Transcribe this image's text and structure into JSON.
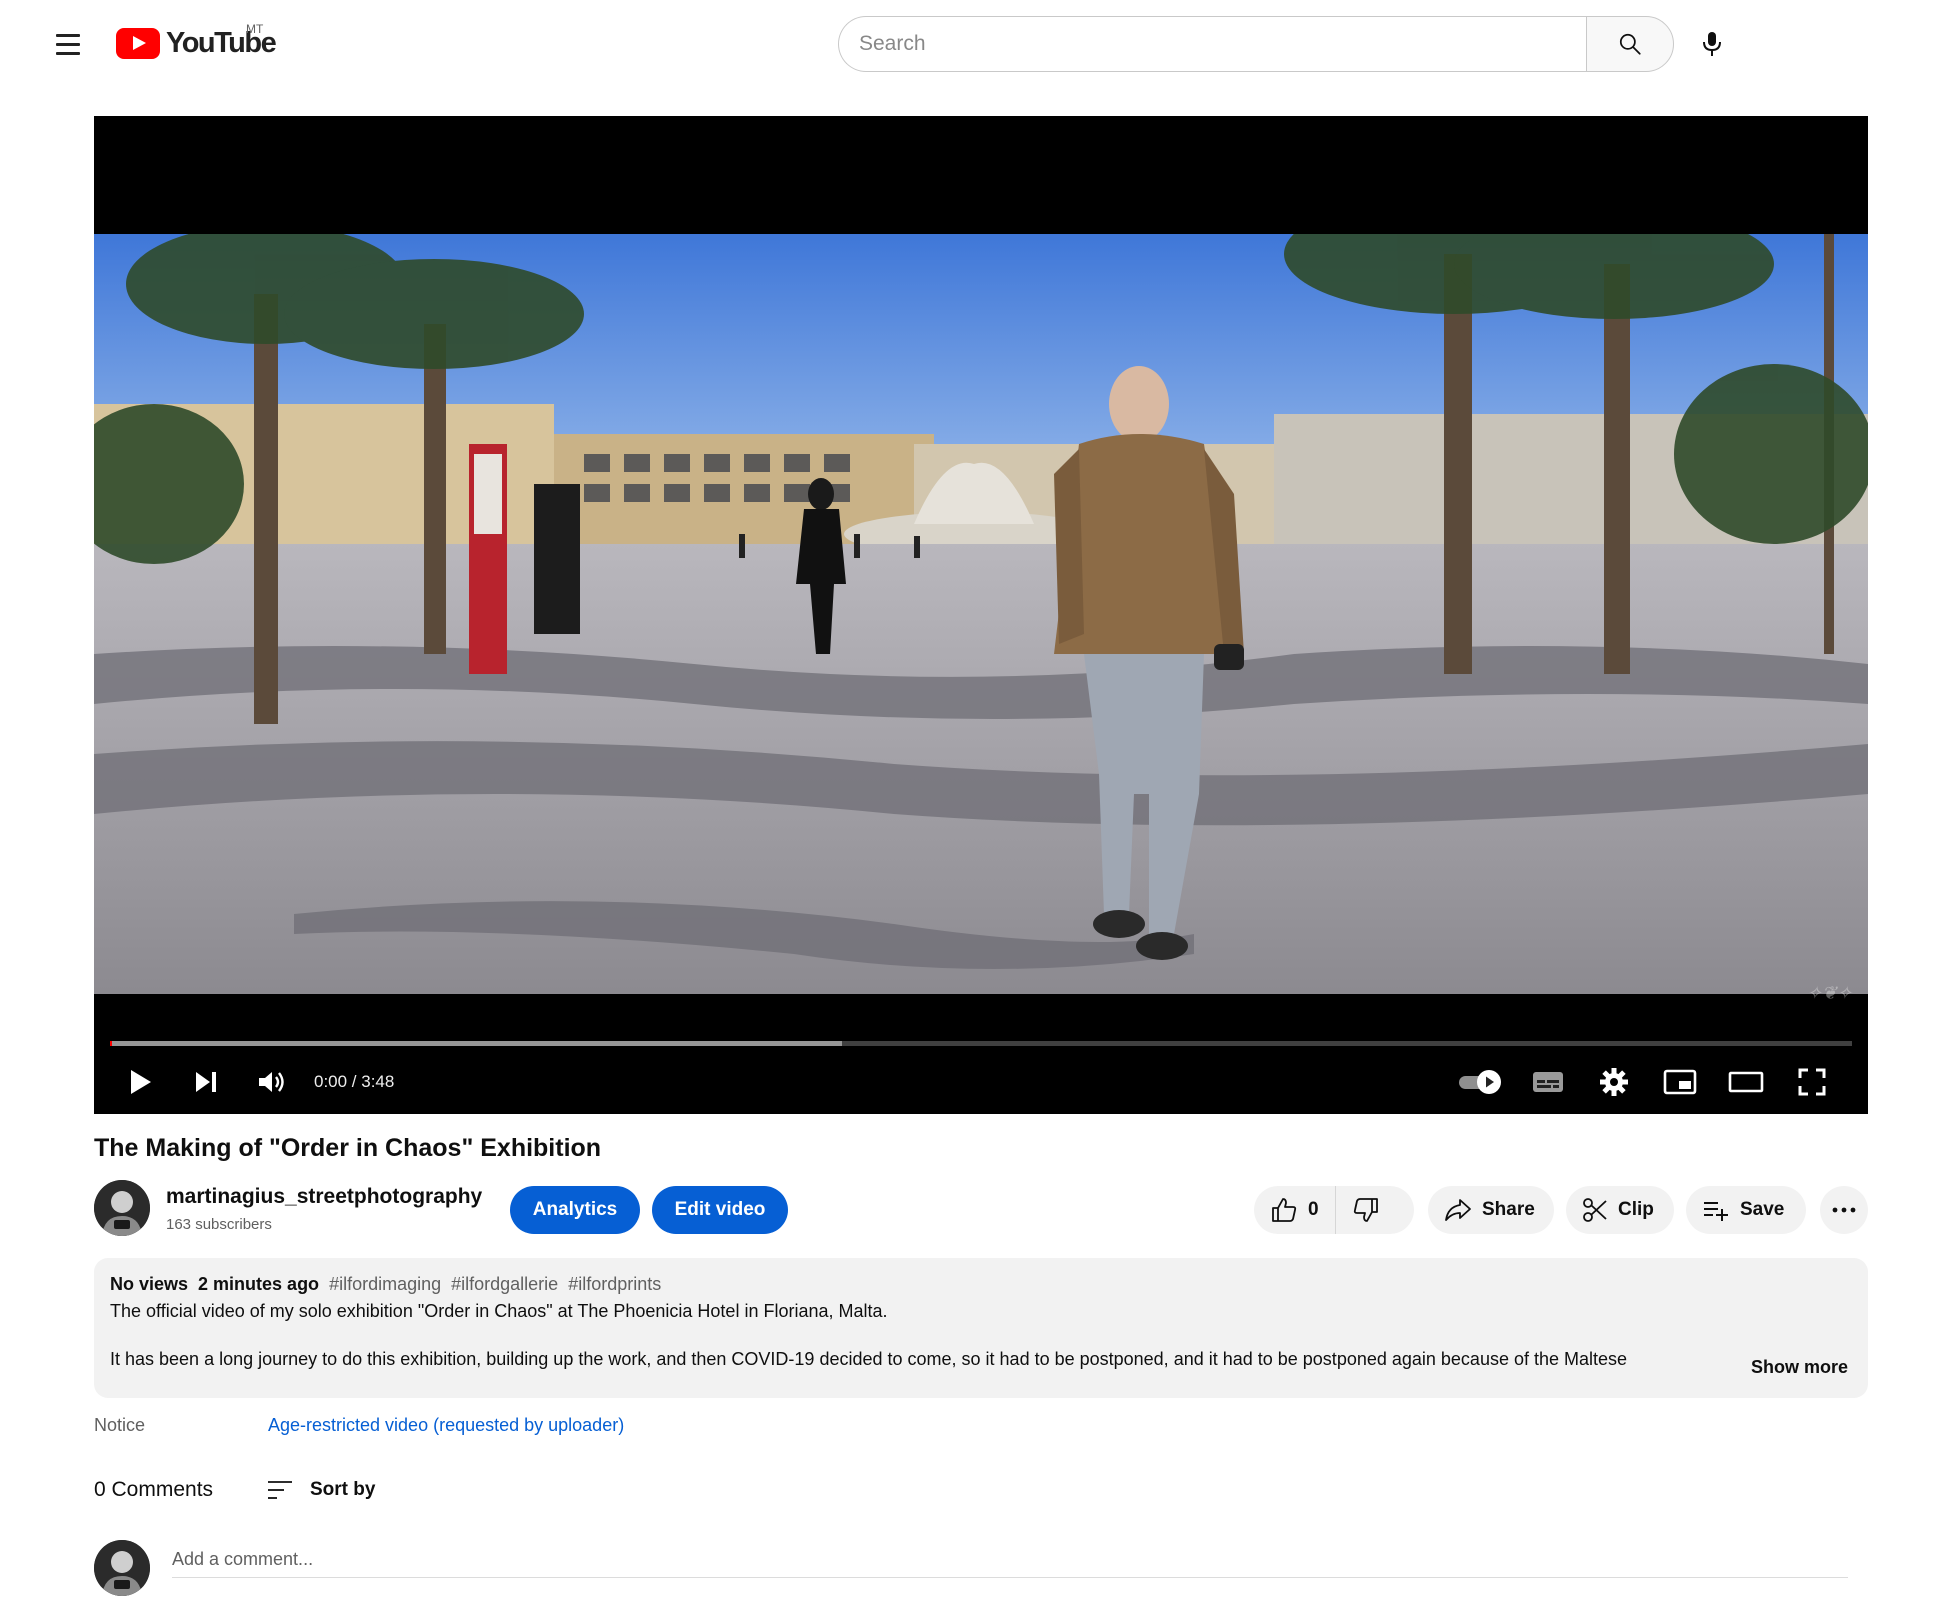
{
  "masthead": {
    "logo_text": "YouTube",
    "country_code": "MT",
    "search_placeholder": "Search"
  },
  "player": {
    "time": "0:00 / 3:48",
    "buffered_fraction": 0.42,
    "watermark": "✧❦✧"
  },
  "video": {
    "title": "The Making of \"Order in Chaos\" Exhibition"
  },
  "owner": {
    "channel_name": "martinagius_streetphotography",
    "subscribers": "163 subscribers",
    "analytics_label": "Analytics",
    "edit_label": "Edit video"
  },
  "actions": {
    "like_count": "0",
    "share_label": "Share",
    "clip_label": "Clip",
    "save_label": "Save"
  },
  "description": {
    "views": "No views",
    "date": "2 minutes ago",
    "hashtags": [
      "#ilfordimaging",
      "#ilfordgallerie",
      "#ilfordprints"
    ],
    "line1": "The official video of my solo exhibition \"Order in Chaos\" at The Phoenicia Hotel in Floriana, Malta.",
    "line2": "It has been a long journey to do this exhibition, building up the work, and then COVID-19 decided to come, so it had to be postponed, and it had to be postponed again because of the Maltese",
    "show_more": "Show more"
  },
  "notice": {
    "label": "Notice",
    "value": "Age-restricted video (requested by uploader)"
  },
  "comments": {
    "count_label": "0 Comments",
    "sort_label": "Sort by",
    "add_placeholder": "Add a comment..."
  },
  "colors": {
    "brand_red": "#ff0000",
    "accent_blue": "#065fd4",
    "chip_grey": "#f2f2f2"
  }
}
